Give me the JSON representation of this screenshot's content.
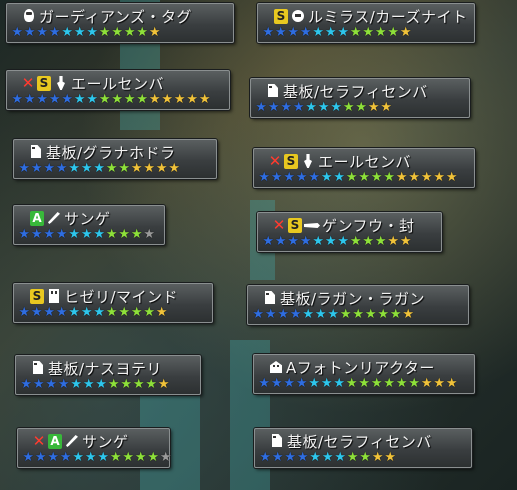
{
  "items": [
    {
      "name": "ガーディアンズ・タグ",
      "x": false,
      "s": false,
      "a": false,
      "icon": "mask-icon",
      "stars": [
        "blue",
        "blue",
        "blue",
        "blue",
        "cyan",
        "cyan",
        "cyan",
        "green",
        "green",
        "green",
        "green",
        "gold"
      ]
    },
    {
      "name": "ルミラス/カーズナイト",
      "x": false,
      "s": true,
      "a": false,
      "icon": "arm-icon",
      "stars": [
        "blue",
        "blue",
        "blue",
        "blue",
        "cyan",
        "cyan",
        "cyan",
        "green",
        "green",
        "green",
        "green",
        "gold"
      ]
    },
    {
      "name": "エールセンバ",
      "x": true,
      "s": true,
      "a": false,
      "icon": "rod-icon",
      "stars": [
        "blue",
        "blue",
        "blue",
        "blue",
        "blue",
        "cyan",
        "cyan",
        "green",
        "green",
        "green",
        "green",
        "gold",
        "gold",
        "gold",
        "gold",
        "gold"
      ]
    },
    {
      "name": "基板/セラフィセンバ",
      "x": false,
      "s": false,
      "a": false,
      "icon": "doc-icon",
      "stars": [
        "blue",
        "blue",
        "blue",
        "blue",
        "cyan",
        "cyan",
        "cyan",
        "green",
        "green",
        "gold",
        "gold"
      ]
    },
    {
      "name": "基板/グラナホドラ",
      "x": false,
      "s": false,
      "a": false,
      "icon": "doc-icon",
      "stars": [
        "blue",
        "blue",
        "blue",
        "blue",
        "cyan",
        "cyan",
        "cyan",
        "green",
        "green",
        "gold",
        "gold",
        "gold",
        "gold"
      ]
    },
    {
      "name": "エールセンバ",
      "x": true,
      "s": true,
      "a": false,
      "icon": "rod-icon",
      "stars": [
        "blue",
        "blue",
        "blue",
        "blue",
        "blue",
        "cyan",
        "cyan",
        "green",
        "green",
        "green",
        "green",
        "gold",
        "gold",
        "gold",
        "gold",
        "gold"
      ]
    },
    {
      "name": "サンゲ",
      "x": false,
      "s": false,
      "a": true,
      "icon": "katana-icon",
      "stars": [
        "blue",
        "blue",
        "blue",
        "blue",
        "cyan",
        "cyan",
        "cyan",
        "green",
        "green",
        "green",
        "gray"
      ]
    },
    {
      "name": "ゲンフウ・封",
      "x": true,
      "s": true,
      "a": false,
      "icon": "rifle-icon",
      "stars": [
        "blue",
        "blue",
        "blue",
        "blue",
        "cyan",
        "cyan",
        "cyan",
        "green",
        "green",
        "green",
        "gold",
        "gold"
      ]
    },
    {
      "name": "ヒゼリ/マインド",
      "x": false,
      "s": true,
      "a": false,
      "icon": "unit-icon",
      "stars": [
        "blue",
        "blue",
        "blue",
        "blue",
        "cyan",
        "cyan",
        "cyan",
        "green",
        "green",
        "green",
        "green",
        "gold"
      ]
    },
    {
      "name": "基板/ラガン・ラガン",
      "x": false,
      "s": false,
      "a": false,
      "icon": "doc-icon",
      "stars": [
        "blue",
        "blue",
        "blue",
        "blue",
        "cyan",
        "cyan",
        "cyan",
        "green",
        "green",
        "green",
        "green",
        "green",
        "gold"
      ]
    },
    {
      "name": "基板/ナスヨテリ",
      "x": false,
      "s": false,
      "a": false,
      "icon": "doc-icon",
      "stars": [
        "blue",
        "blue",
        "blue",
        "blue",
        "cyan",
        "cyan",
        "cyan",
        "green",
        "green",
        "green",
        "green",
        "gold"
      ]
    },
    {
      "name": "Aフォトンリアクター",
      "x": false,
      "s": false,
      "a": false,
      "icon": "head-icon",
      "stars": [
        "blue",
        "blue",
        "blue",
        "blue",
        "cyan",
        "cyan",
        "cyan",
        "green",
        "green",
        "green",
        "green",
        "green",
        "green",
        "gold",
        "gold",
        "gold"
      ]
    },
    {
      "name": "サンゲ",
      "x": true,
      "s": false,
      "a": true,
      "icon": "katana-icon",
      "stars": [
        "blue",
        "blue",
        "blue",
        "blue",
        "cyan",
        "cyan",
        "cyan",
        "green",
        "green",
        "green",
        "green",
        "gray"
      ]
    },
    {
      "name": "基板/セラフィセンバ",
      "x": false,
      "s": false,
      "a": false,
      "icon": "doc-icon",
      "stars": [
        "blue",
        "blue",
        "blue",
        "blue",
        "cyan",
        "cyan",
        "cyan",
        "green",
        "green",
        "gold",
        "gold"
      ]
    }
  ]
}
